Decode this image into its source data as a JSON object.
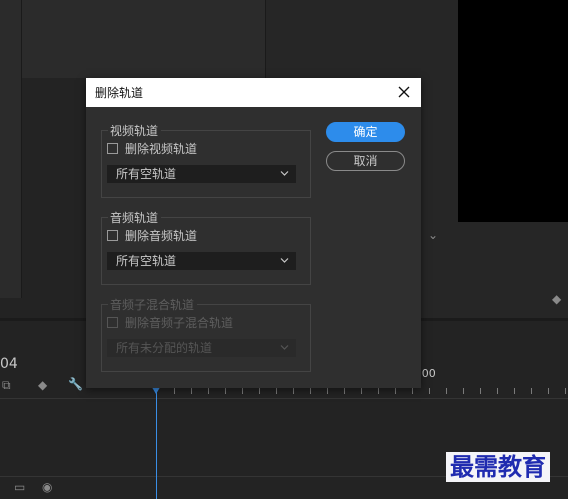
{
  "dialog": {
    "title": "删除轨道",
    "ok_label": "确定",
    "cancel_label": "取消",
    "video_group": {
      "legend": "视频轨道",
      "checkbox_label": "删除视频轨道",
      "checked": false,
      "select_value": "所有空轨道"
    },
    "audio_group": {
      "legend": "音频轨道",
      "checkbox_label": "删除音频轨道",
      "checked": false,
      "select_value": "所有空轨道"
    },
    "submix_group": {
      "legend": "音频子混合轨道",
      "checkbox_label": "删除音频子混合轨道",
      "checked": false,
      "select_value": "所有未分配的轨道",
      "disabled": true
    }
  },
  "timeline": {
    "timecode_fragment": "04",
    "ruler_label": ":00"
  },
  "watermark": "最需教育",
  "colors": {
    "accent": "#2d8ceb",
    "playhead": "#3a8ee6",
    "dialog_bg": "#2f2f2f",
    "titlebar_bg": "#ffffff"
  }
}
